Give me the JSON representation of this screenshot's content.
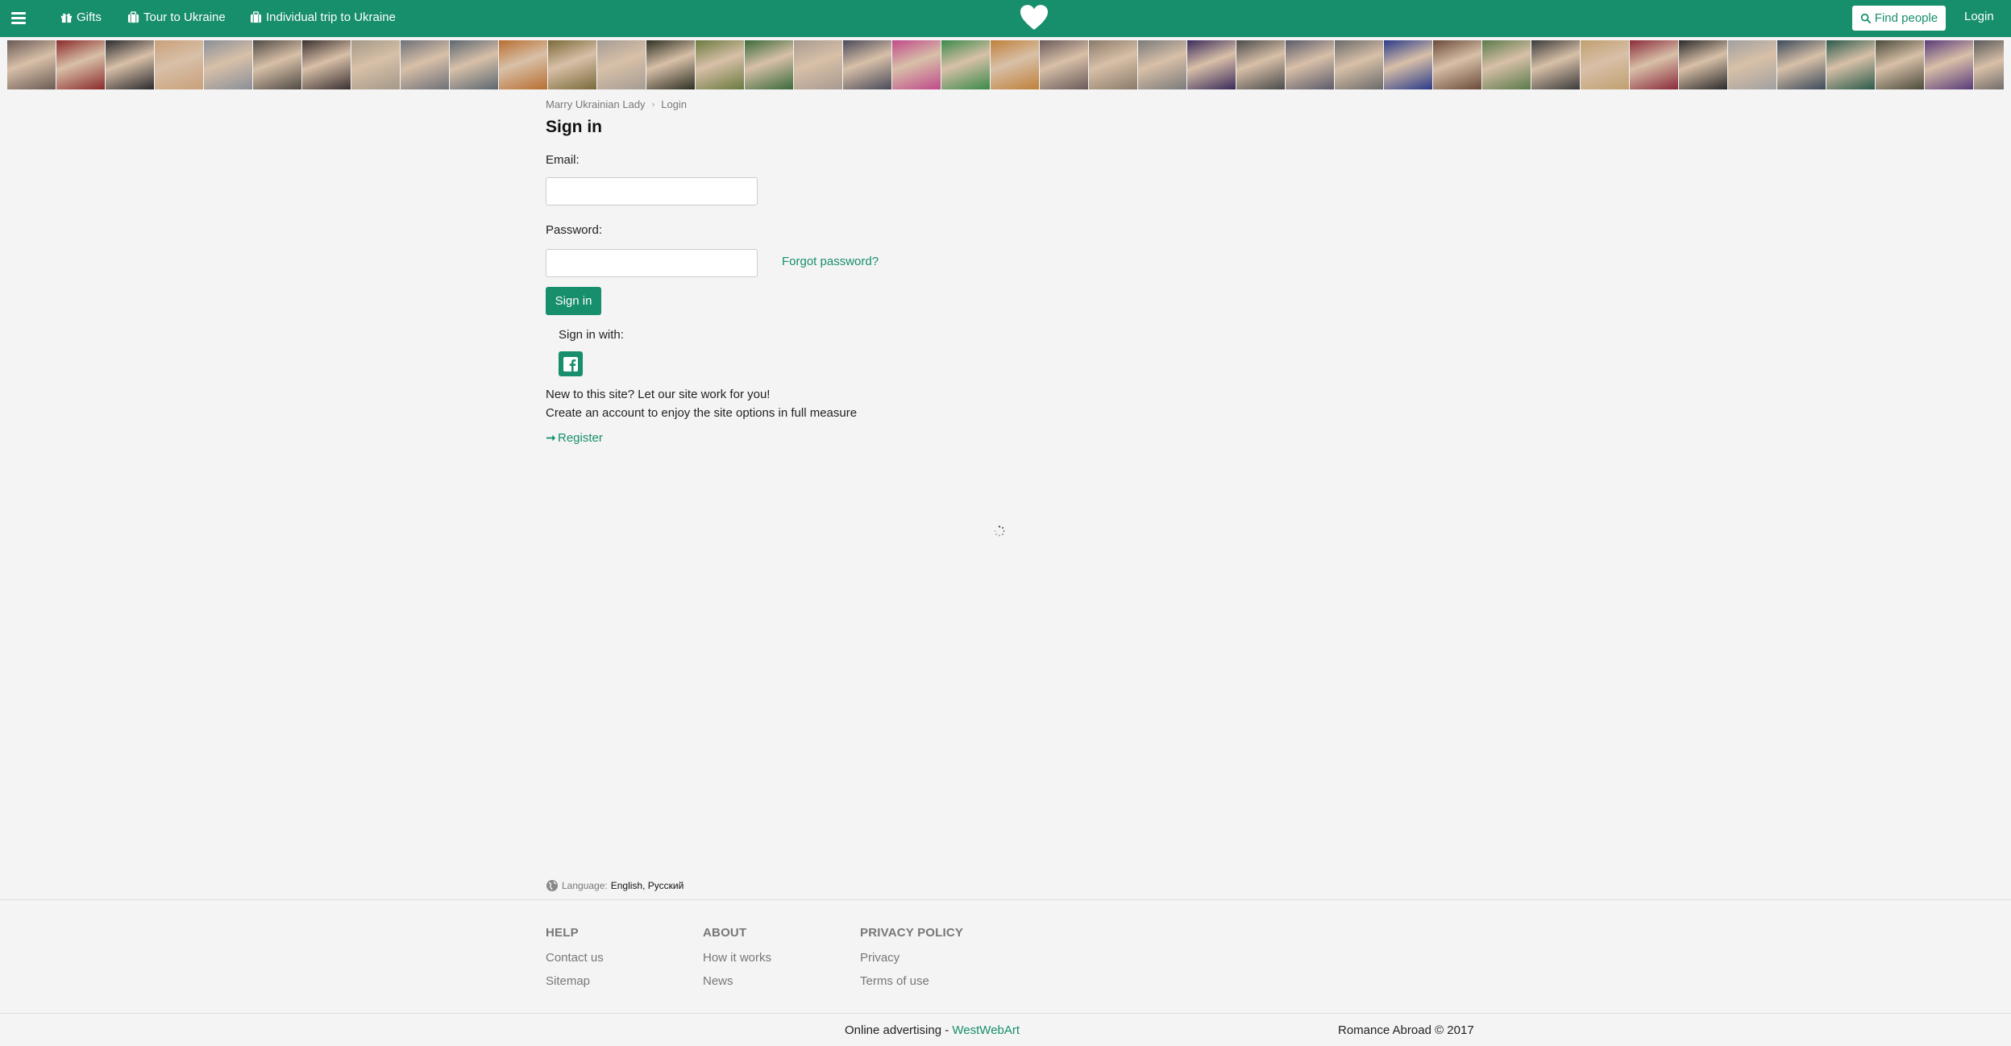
{
  "header": {
    "nav": [
      {
        "label": "Gifts",
        "icon": "gift-icon"
      },
      {
        "label": "Tour to Ukraine",
        "icon": "suitcase-icon"
      },
      {
        "label": "Individual trip to Ukraine",
        "icon": "suitcase-icon"
      }
    ],
    "logo_icon": "heart-icon",
    "find_label": "Find people",
    "login_label": "Login"
  },
  "photo_strip": {
    "colors": [
      "#6a5a55",
      "#8a2a2a",
      "#2a2a2e",
      "#c9a07a",
      "#8a8f98",
      "#4e4a44",
      "#3a3030",
      "#a39888",
      "#6e7078",
      "#5b6772",
      "#b86e30",
      "#7a6a3a",
      "#a59c94",
      "#2e3024",
      "#6a7a40",
      "#3a6a3a",
      "#a89a90",
      "#4a4a5a",
      "#c04a8a",
      "#3a8a4a",
      "#c0803a",
      "#6a5a5a",
      "#8a7a6a",
      "#7a7a7a",
      "#3a2a5a",
      "#4a4a4a",
      "#5a5a6a",
      "#6a6a6a",
      "#2a3a8a",
      "#6a4a3a",
      "#5a7a4a",
      "#3a3a3a",
      "#c0a070",
      "#8a2a3a",
      "#2a2a2a",
      "#a0a0a0",
      "#3a4a5a",
      "#2a5a4a",
      "#4a4a3a",
      "#5a3a7a",
      "#5a5a5a"
    ]
  },
  "breadcrumb": {
    "home": "Marry Ukrainian Lady",
    "current": "Login"
  },
  "form": {
    "title": "Sign in",
    "email_label": "Email:",
    "email_value": "",
    "password_label": "Password:",
    "password_value": "",
    "forgot_label": "Forgot password?",
    "submit_label": "Sign in",
    "signin_with_label": "Sign in with:",
    "social_icon": "facebook-icon",
    "new_line1": "New to this site? Let our site work for you!",
    "new_line2": "Create an account to enjoy the site options in full measure",
    "register_label": "Register"
  },
  "language": {
    "label": "Language:",
    "options": "English, Русский"
  },
  "footer": {
    "columns": [
      {
        "title": "HELP",
        "items": [
          "Contact us",
          "Sitemap"
        ]
      },
      {
        "title": "ABOUT",
        "items": [
          "How it works",
          "News"
        ]
      },
      {
        "title": "PRIVACY POLICY",
        "items": [
          "Privacy",
          "Terms of use"
        ]
      }
    ],
    "ad_prefix": "Online advertising -",
    "ad_brand": "WestWebArt",
    "copyright": "Romance Abroad © 2017"
  },
  "colors": {
    "brand": "#178e6c",
    "background": "#f4f4f4"
  }
}
